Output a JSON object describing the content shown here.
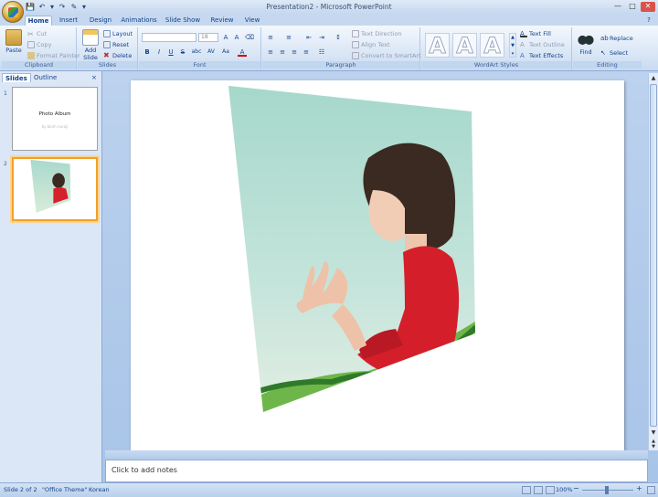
{
  "window": {
    "title": "Presentation2 - Microsoft PowerPoint"
  },
  "tabs": [
    "Home",
    "Insert",
    "Design",
    "Animations",
    "Slide Show",
    "Review",
    "View"
  ],
  "ribbon": {
    "clipboard": {
      "label": "Clipboard",
      "paste": "Paste",
      "cut": "Cut",
      "copy": "Copy",
      "format_painter": "Format Painter"
    },
    "slides": {
      "label": "Slides",
      "add_slide": "Add Slide",
      "layout": "Layout",
      "reset": "Reset",
      "delete": "Delete"
    },
    "font": {
      "label": "Font",
      "font_name": "",
      "font_size": "18",
      "bold": "B",
      "italic": "I",
      "underline": "U",
      "strike": "S",
      "shadow": "abc",
      "spacing": "AV",
      "case": "Aa"
    },
    "paragraph": {
      "label": "Paragraph",
      "text_direction": "Text Direction",
      "align_text": "Align Text",
      "convert_smartart": "Convert to SmartArt"
    },
    "wordart": {
      "label": "WordArt Styles",
      "letter": "A",
      "text_fill": "Text Fill",
      "text_outline": "Text Outline",
      "text_effects": "Text Effects"
    },
    "editing": {
      "label": "Editing",
      "find": "Find",
      "replace": "Replace",
      "select": "Select"
    }
  },
  "panel": {
    "tab_slides": "Slides",
    "tab_outline": "Outline",
    "close": "×",
    "thumbs": [
      {
        "num": "1",
        "title": "Photo Album",
        "subtitle": "by bkim nuraji"
      },
      {
        "num": "2"
      }
    ]
  },
  "notes": {
    "placeholder": "Click to add notes"
  },
  "status": {
    "slide": "Slide 2 of 2",
    "theme": "\"Office Theme\"",
    "language": "Korean",
    "zoom": "100%"
  },
  "colors": {
    "accent": "#15428b",
    "ribbon_bg": "#dbe7f6",
    "selection": "#f0a030"
  }
}
